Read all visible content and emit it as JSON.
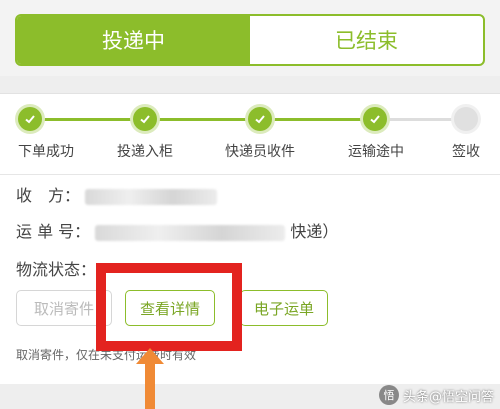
{
  "tabs": [
    {
      "label": "投递中",
      "active": true
    },
    {
      "label": "已结束",
      "active": false
    }
  ],
  "progress": {
    "steps": [
      {
        "label": "下单成功",
        "done": true
      },
      {
        "label": "投递入柜",
        "done": true
      },
      {
        "label": "快递员收件",
        "done": true
      },
      {
        "label": "运输途中",
        "done": true
      },
      {
        "label": "签收",
        "done": false
      }
    ]
  },
  "info": {
    "recipient_label": "收　方：",
    "tracking_label": "运 单 号：",
    "tracking_suffix": "快递）",
    "status_label": "物流状态："
  },
  "actions": {
    "cancel": "取消寄件",
    "view_details": "查看详情",
    "e_waybill": "电子运单"
  },
  "note": "取消寄件，仅在未支付运费时有效",
  "watermark": "头条@悟空问答",
  "colors": {
    "accent": "#8cbd2b",
    "highlight": "#e3231f",
    "arrow": "#f08a35"
  }
}
